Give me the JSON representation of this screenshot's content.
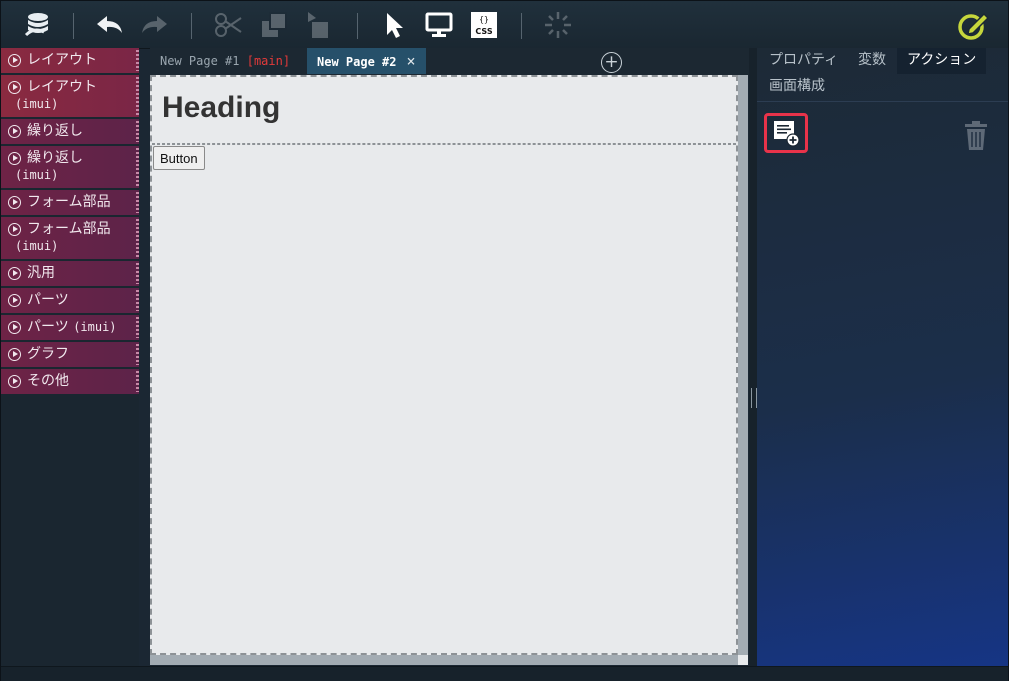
{
  "toolbar": {
    "icons": [
      "app-logo-icon",
      "undo-icon",
      "redo-icon",
      "cut-icon",
      "copy-icon",
      "paste-icon",
      "select-icon",
      "preview-icon",
      "css-icon",
      "loading-icon",
      "edit-mode-icon"
    ],
    "css_label": "CSS",
    "accent_color": "#c6d63c"
  },
  "palette": {
    "categories": [
      {
        "label": "レイアウト"
      },
      {
        "label": "レイアウト",
        "sub": "(imui)"
      },
      {
        "label": "繰り返し"
      },
      {
        "label": "繰り返し",
        "sub": "(imui)"
      },
      {
        "label": "フォーム部品"
      },
      {
        "label": "フォーム部品",
        "sub": "(imui)"
      },
      {
        "label": "汎用"
      },
      {
        "label": "パーツ"
      },
      {
        "label": "パーツ",
        "mono": "(imui)"
      },
      {
        "label": "グラフ"
      },
      {
        "label": "その他"
      }
    ]
  },
  "tabs": {
    "page1": "New Page #1",
    "page1_tag": "[main]",
    "page2": "New Page #2",
    "close": "×",
    "add": "+"
  },
  "canvas": {
    "heading": "Heading",
    "button": "Button"
  },
  "right": {
    "tabs": [
      "プロパティ",
      "変数",
      "アクション",
      "画面構成"
    ],
    "active_tab": "アクション"
  },
  "colors": {
    "highlight": "#e8334a",
    "category_bg": "#6e2346"
  }
}
